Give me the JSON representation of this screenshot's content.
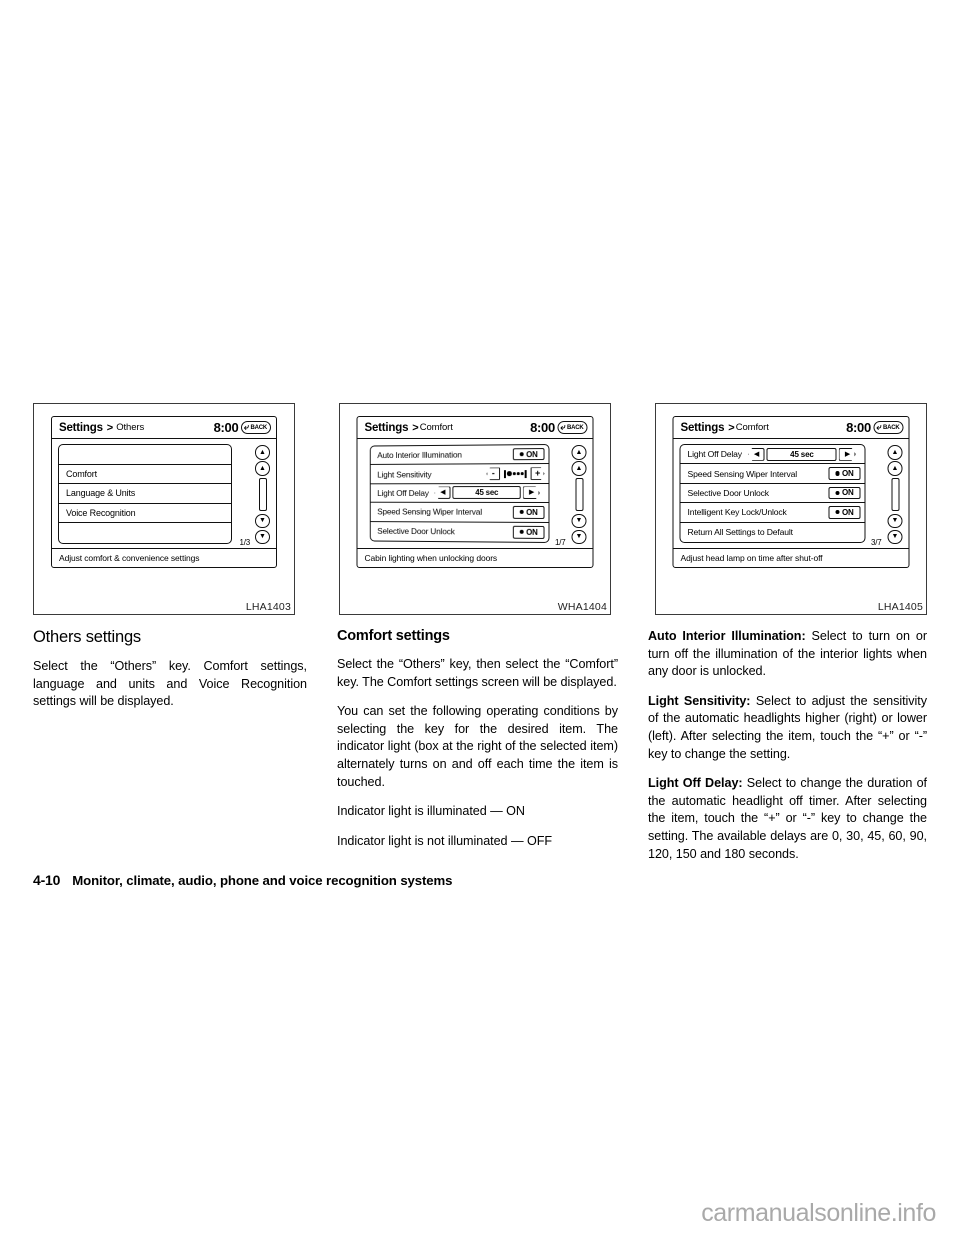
{
  "figures": [
    {
      "caption": "LHA1403",
      "screen": {
        "breadcrumb_root": "Settings",
        "breadcrumb_sep": ">",
        "breadcrumb_node": "Others",
        "clock": "8:00",
        "back_label": "BACK",
        "back_icon": "back-arrow-icon",
        "page_indicator": "1/3",
        "status_text": "Adjust comfort & convenience settings",
        "rows": [
          {
            "label": "",
            "control": "none"
          },
          {
            "label": "Comfort",
            "control": "none"
          },
          {
            "label": "Language & Units",
            "control": "none"
          },
          {
            "label": "Voice Recognition",
            "control": "none"
          },
          {
            "label": "",
            "control": "none"
          }
        ],
        "scroll_buttons": [
          "scroll-top-icon",
          "scroll-up-icon",
          "scroll-down-icon",
          "scroll-bottom-icon"
        ]
      }
    },
    {
      "caption": "WHA1404",
      "screen": {
        "breadcrumb_root": "Settings",
        "breadcrumb_sep": ">",
        "breadcrumb_node": "Comfort",
        "clock": "8:00",
        "back_label": "BACK",
        "back_icon": "back-arrow-icon",
        "page_indicator": "1/7",
        "status_text": "Cabin lighting when unlocking doors",
        "rows": [
          {
            "label": "Auto Interior Illumination",
            "control": "toggle",
            "value": "ON"
          },
          {
            "label": "Light Sensitivity",
            "control": "stepper",
            "minus": "-",
            "plus": "+",
            "level": 1,
            "level_max": 4
          },
          {
            "label": "Light Off Delay",
            "control": "spinner",
            "value": "45 sec",
            "prev_icon": "arrow-left-icon",
            "next_icon": "arrow-right-icon"
          },
          {
            "label": "Speed Sensing Wiper Interval",
            "control": "toggle",
            "value": "ON"
          },
          {
            "label": "Selective Door Unlock",
            "control": "toggle",
            "value": "ON"
          }
        ],
        "scroll_buttons": [
          "scroll-top-icon",
          "scroll-up-icon",
          "scroll-down-icon",
          "scroll-bottom-icon"
        ]
      }
    },
    {
      "caption": "LHA1405",
      "screen": {
        "breadcrumb_root": "Settings",
        "breadcrumb_sep": ">",
        "breadcrumb_node": "Comfort",
        "clock": "8:00",
        "back_label": "BACK",
        "back_icon": "back-arrow-icon",
        "page_indicator": "3/7",
        "status_text": "Adjust head lamp on time after shut-off",
        "rows": [
          {
            "label": "Light Off Delay",
            "control": "spinner",
            "value": "45 sec",
            "prev_icon": "arrow-left-icon",
            "next_icon": "arrow-right-icon"
          },
          {
            "label": "Speed Sensing Wiper Interval",
            "control": "toggle",
            "value": "ON"
          },
          {
            "label": "Selective Door Unlock",
            "control": "toggle",
            "value": "ON"
          },
          {
            "label": "Intelligent Key Lock/Unlock",
            "control": "toggle",
            "value": "ON"
          },
          {
            "label": "Return All Settings to Default",
            "control": "none"
          }
        ],
        "scroll_buttons": [
          "scroll-top-icon",
          "scroll-up-icon",
          "scroll-down-icon",
          "scroll-bottom-icon"
        ]
      }
    }
  ],
  "columns": {
    "col1": {
      "heading": "Others settings",
      "p1": "Select the “Others” key. Comfort settings, language and units and Voice Recognition settings will be displayed."
    },
    "col2": {
      "heading": "Comfort settings",
      "p1": "Select the “Others” key, then select the “Comfort” key. The Comfort settings screen will be displayed.",
      "p2": "You can set the following operating conditions by selecting the key for the desired item. The indicator light (box at the right of the selected item) alternately turns on and off each time the item is touched.",
      "p3": "Indicator light is illuminated — ON",
      "p4": "Indicator light is not illuminated — OFF"
    },
    "col3": {
      "p1_term": "Auto Interior Illumination:",
      "p1_body": " Select to turn on or turn off the illumination of the interior lights when any door is unlocked.",
      "p2_term": "Light Sensitivity:",
      "p2_body": " Select to adjust the sensitivity of the automatic headlights higher (right) or lower (left). After selecting the item, touch the “+” or “-” key to change the setting.",
      "p3_term": "Light Off Delay:",
      "p3_body": " Select to change the duration of the automatic headlight off timer. After selecting the item, touch the “+” or “-” key to change the setting. The available delays are 0, 30, 45, 60, 90, 120, 150 and 180 seconds."
    }
  },
  "footer": {
    "page_number": "4-10",
    "section_title": "Monitor, climate, audio, phone and voice recognition systems"
  },
  "watermark": "carmanualsonline.info"
}
